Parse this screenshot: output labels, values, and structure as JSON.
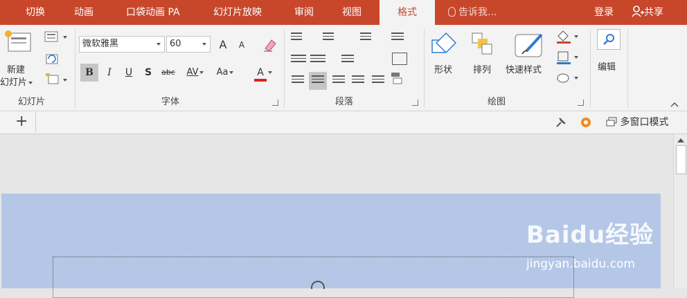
{
  "ribbon_tabs": [
    "切换",
    "动画",
    "口袋动画 PA",
    "幻灯片放映",
    "审阅",
    "视图",
    "格式"
  ],
  "active_tab": "格式",
  "tell_me": "告诉我...",
  "login": "登录",
  "share": "共享",
  "groups": {
    "slides": {
      "label": "幻灯片",
      "new_slide_line1": "新建",
      "new_slide_line2": "幻灯片"
    },
    "font": {
      "label": "字体",
      "font_name": "微软雅黑",
      "font_size": "60",
      "grow": "A",
      "shrink": "A",
      "bold": "B",
      "italic": "I",
      "underline": "U",
      "shadow": "S",
      "strike": "abc",
      "spacing": "AV",
      "case": "Aa",
      "color": "A"
    },
    "paragraph": {
      "label": "段落"
    },
    "drawing": {
      "label": "绘图",
      "shape": "形状",
      "arrange": "排列",
      "quick_styles": "快速样式"
    },
    "editing": {
      "label": "编辑"
    }
  },
  "toolrow": {
    "plus": "+",
    "multi_window": "多窗口模式"
  },
  "watermark": {
    "brand": "Baidu经验",
    "url": "jingyan.baidu.com"
  },
  "colors": {
    "accent": "#c8472b",
    "slide_bg": "#b4c7e7",
    "font_color_bar": "#e0201b"
  }
}
